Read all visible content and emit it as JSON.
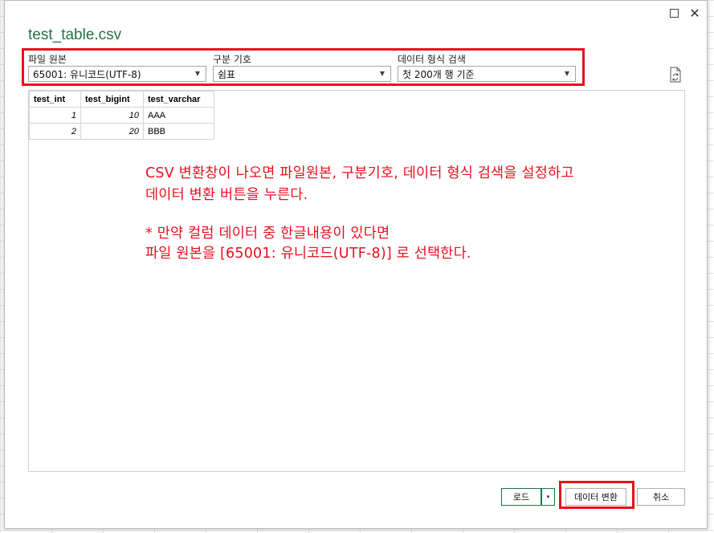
{
  "dialog": {
    "title": "test_table.csv",
    "maximize_label": "☐",
    "close_label": "✕"
  },
  "options": {
    "file_origin": {
      "label": "파일 원본",
      "value": "65001: 유니코드(UTF-8)"
    },
    "delimiter": {
      "label": "구분 기호",
      "value": "쉼표"
    },
    "data_type_detection": {
      "label": "데이터 형식 검색",
      "value": "첫 200개 행 기준"
    }
  },
  "preview_table": {
    "columns": [
      "test_int",
      "test_bigint",
      "test_varchar"
    ],
    "rows": [
      [
        "1",
        "10",
        "AAA"
      ],
      [
        "2",
        "20",
        "BBB"
      ]
    ]
  },
  "annotation": {
    "line1": "CSV 변환창이 나오면 파일원본, 구분기호, 데이터 형식 검색을 설정하고",
    "line2": "데이터 변환 버튼을 누른다.",
    "line3": "* 만약 컬럼 데이터 중 한글내용이 있다면",
    "line4": "파일 원본을 [65001: 유니코드(UTF-8)] 로 선택한다."
  },
  "buttons": {
    "load": "로드",
    "load_dropdown": "▾",
    "transform": "데이터 변환",
    "cancel": "취소"
  },
  "colors": {
    "accent": "#217346",
    "highlight": "#e8101d"
  }
}
